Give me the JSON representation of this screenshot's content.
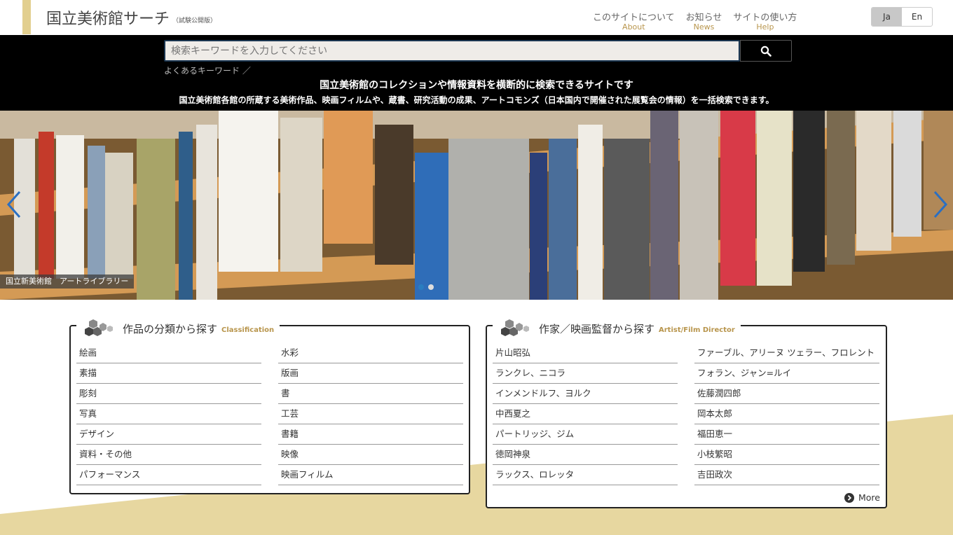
{
  "header": {
    "site_title": "国立美術館サーチ",
    "site_subtitle": "（試験公開版）",
    "nav": [
      {
        "ja": "このサイトについて",
        "en": "About"
      },
      {
        "ja": "お知らせ",
        "en": "News"
      },
      {
        "ja": "サイトの使い方",
        "en": "Help"
      }
    ],
    "lang": {
      "ja": "Ja",
      "en": "En",
      "active": "Ja"
    }
  },
  "search": {
    "placeholder": "検索キーワードを入力してください",
    "button_icon": "search-icon",
    "keywords_label": "よくあるキーワード ／",
    "tagline": "国立美術館のコレクションや情報資料を横断的に検索できるサイトです",
    "tagline_sub": "国立美術館各館の所蔵する美術作品、映画フィルムや、蔵書、研究活動の成果、アートコモンズ（日本国内で開催された展覧会の情報）を一括検索できます。"
  },
  "hero": {
    "caption": "国立新美術館　アートライブラリー",
    "prev_icon": "chevron-left-icon",
    "next_icon": "chevron-right-icon",
    "slides": 2,
    "active_slide": 1
  },
  "classification": {
    "title": "作品の分類から探す",
    "title_en": "Classification",
    "col1": [
      "絵画",
      "素描",
      "彫刻",
      "写真",
      "デザイン",
      "資料・その他",
      "パフォーマンス"
    ],
    "col2": [
      "水彩",
      "版画",
      "書",
      "工芸",
      "書籍",
      "映像",
      "映画フィルム"
    ]
  },
  "artists": {
    "title": "作家／映画監督から探す",
    "title_en": "Artist/Film Director",
    "col1": [
      "片山昭弘",
      "ランクレ、ニコラ",
      "インメンドルフ、ヨルク",
      "中西夏之",
      "パートリッジ、ジム",
      "徳岡神泉",
      "ラックス、ロレッタ"
    ],
    "col2": [
      "ファーブル、アリーヌ ツェラー、フロレント",
      "フォラン、ジャン=ルイ",
      "佐藤潤四郎",
      "岡本太郎",
      "福田恵一",
      "小枝繁昭",
      "吉田政次"
    ],
    "more_label": "More"
  },
  "colors": {
    "accent": "#e2cf8f",
    "brand_gold": "#b8954c",
    "search_band": "#000000",
    "slider_dot_active": "#2a7dc0"
  }
}
